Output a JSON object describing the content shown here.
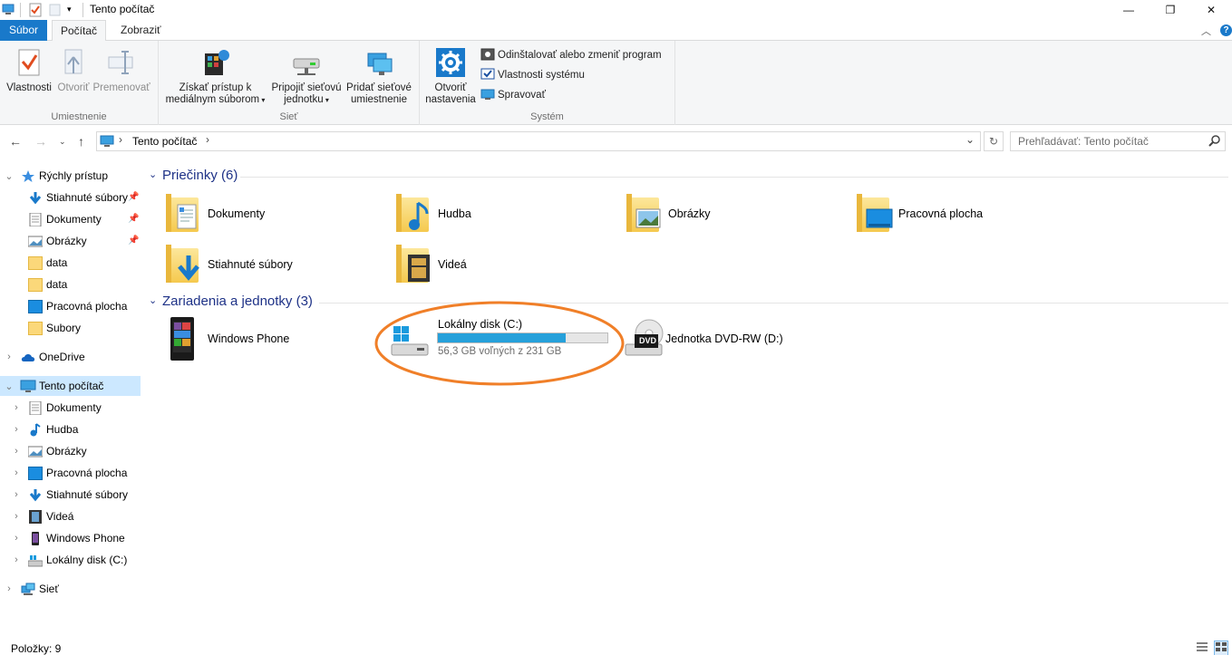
{
  "window": {
    "title": "Tento počítač",
    "minimize": "—",
    "maximize": "❐",
    "close": "✕"
  },
  "tabs": {
    "file": "Súbor",
    "computer": "Počítač",
    "view": "Zobraziť"
  },
  "ribbon": {
    "location": {
      "label": "Umiestnenie",
      "properties": "Vlastnosti",
      "open": "Otvoriť",
      "rename": "Premenovať"
    },
    "network": {
      "label": "Sieť",
      "media_line1": "Získať prístup k",
      "media_line2": "mediálnym súborom",
      "map_line1": "Pripojiť sieťovú",
      "map_line2": "jednotku",
      "add_line1": "Pridať sieťové",
      "add_line2": "umiestnenie"
    },
    "system": {
      "label": "Systém",
      "settings_line1": "Otvoriť",
      "settings_line2": "nastavenia",
      "uninstall": "Odinštalovať alebo zmeniť program",
      "sysprops": "Vlastnosti systému",
      "manage": "Spravovať"
    }
  },
  "address": {
    "path": "Tento počítač",
    "search_placeholder": "Prehľadávať: Tento počítač"
  },
  "navpane": {
    "quick_access": "Rýchly prístup",
    "quick_items": [
      {
        "label": "Stiahnuté súbory"
      },
      {
        "label": "Dokumenty"
      },
      {
        "label": "Obrázky"
      },
      {
        "label": "data"
      },
      {
        "label": "data"
      },
      {
        "label": "Pracovná plocha"
      },
      {
        "label": "Subory"
      }
    ],
    "onedrive": "OneDrive",
    "this_pc": "Tento počítač",
    "pc_items": [
      {
        "label": "Dokumenty"
      },
      {
        "label": "Hudba"
      },
      {
        "label": "Obrázky"
      },
      {
        "label": "Pracovná plocha"
      },
      {
        "label": "Stiahnuté súbory"
      },
      {
        "label": "Videá"
      },
      {
        "label": "Windows Phone"
      },
      {
        "label": "Lokálny disk (C:)"
      }
    ],
    "network": "Sieť"
  },
  "content": {
    "folders_header": "Priečinky (6)",
    "folders": [
      {
        "label": "Dokumenty"
      },
      {
        "label": "Hudba"
      },
      {
        "label": "Obrázky"
      },
      {
        "label": "Pracovná plocha"
      },
      {
        "label": "Stiahnuté súbory"
      },
      {
        "label": "Videá"
      }
    ],
    "devices_header": "Zariadenia a jednotky (3)",
    "devices": {
      "phone": "Windows Phone",
      "disk_name": "Lokálny disk (C:)",
      "disk_free": "56,3 GB voľných z 231 GB",
      "disk_used_fraction": 0.756,
      "dvd": "Jednotka DVD-RW (D:)",
      "dvd_badge": "DVD"
    }
  },
  "status": {
    "items": "Položky: 9"
  },
  "colors": {
    "accent": "#1979ca",
    "header_blue": "#1e3287",
    "selection": "#cce8ff",
    "drive_fill": "#26a0da",
    "annotation": "#f07f28"
  }
}
